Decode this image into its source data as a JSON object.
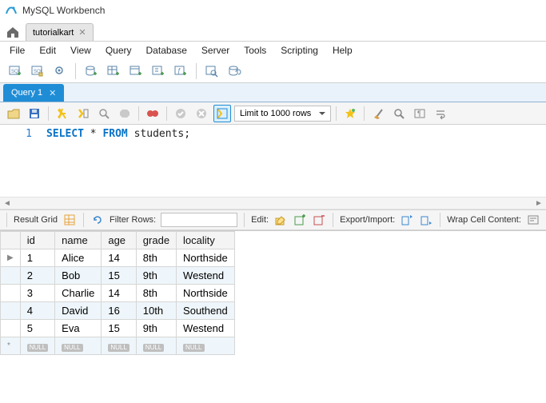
{
  "app": {
    "title": "MySQL Workbench"
  },
  "connection_tabs": [
    {
      "label": "tutorialkart"
    }
  ],
  "menu": [
    "File",
    "Edit",
    "View",
    "Query",
    "Database",
    "Server",
    "Tools",
    "Scripting",
    "Help"
  ],
  "query_tabs": [
    {
      "label": "Query 1"
    }
  ],
  "editor": {
    "limit_label": "Limit to 1000 rows",
    "line_number": "1",
    "sql_kw_select": "SELECT",
    "sql_star": "*",
    "sql_kw_from": "FROM",
    "sql_ident": "students",
    "sql_semicolon": ";"
  },
  "result_bar": {
    "result_grid_label": "Result Grid",
    "filter_rows_label": "Filter Rows:",
    "filter_value": "",
    "edit_label": "Edit:",
    "export_import_label": "Export/Import:",
    "wrap_cell_label": "Wrap Cell Content:"
  },
  "result": {
    "columns": [
      "id",
      "name",
      "age",
      "grade",
      "locality"
    ],
    "rows": [
      {
        "id": "1",
        "name": "Alice",
        "age": "14",
        "grade": "8th",
        "locality": "Northside"
      },
      {
        "id": "2",
        "name": "Bob",
        "age": "15",
        "grade": "9th",
        "locality": "Westend"
      },
      {
        "id": "3",
        "name": "Charlie",
        "age": "14",
        "grade": "8th",
        "locality": "Northside"
      },
      {
        "id": "4",
        "name": "David",
        "age": "16",
        "grade": "10th",
        "locality": "Southend"
      },
      {
        "id": "5",
        "name": "Eva",
        "age": "15",
        "grade": "9th",
        "locality": "Westend"
      }
    ],
    "null_label": "NULL"
  }
}
